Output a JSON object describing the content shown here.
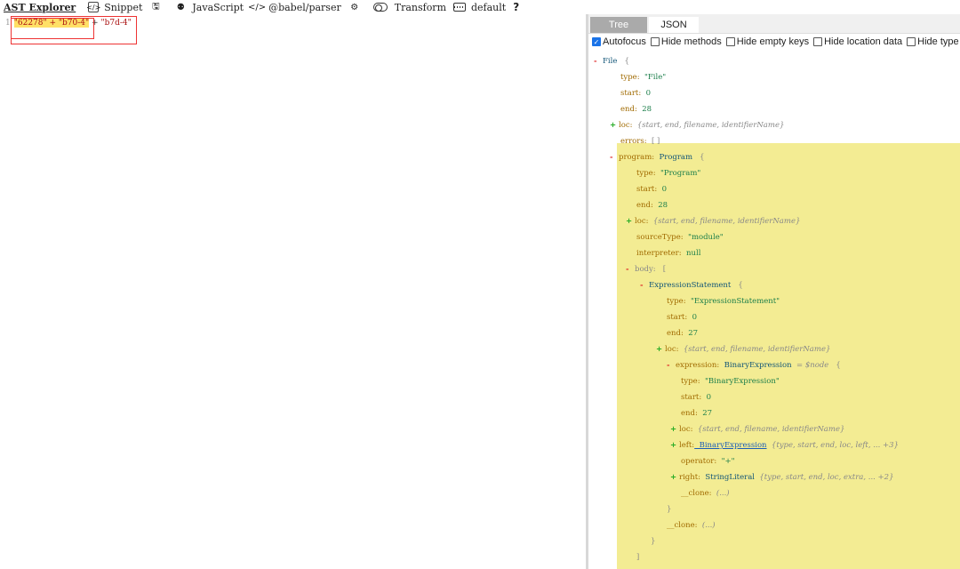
{
  "toolbar": {
    "brand": "AST Explorer",
    "snippet": "Snippet",
    "language": "JavaScript",
    "parser": "@babel/parser",
    "transform": "Transform",
    "theme": "default",
    "help": "?"
  },
  "editor": {
    "line_number": "1",
    "code_highlighted": "\"62278\" + \"b70-4\"",
    "code_op": " + ",
    "code_rest": "\"b7d-4\""
  },
  "panel": {
    "tabs": [
      "Tree",
      "JSON"
    ],
    "options": [
      {
        "label": "Autofocus",
        "checked": true
      },
      {
        "label": "Hide methods",
        "checked": false
      },
      {
        "label": "Hide empty keys",
        "checked": false
      },
      {
        "label": "Hide location data",
        "checked": false
      },
      {
        "label": "Hide type",
        "checked": false
      }
    ]
  },
  "tree": [
    {
      "toggle": "-",
      "key": "File",
      "kind": "type",
      "suffix": "{"
    },
    {
      "toggle": "",
      "key": "type:",
      "value": "\"File\"",
      "vt": "str"
    },
    {
      "toggle": "",
      "key": "start:",
      "value": "0",
      "vt": "num"
    },
    {
      "toggle": "",
      "key": "end:",
      "value": "28",
      "vt": "num"
    },
    {
      "toggle": "+",
      "key": "loc:",
      "value": "{start, end, filename, identifierName}",
      "vt": "meta"
    },
    {
      "toggle": "",
      "key": "errors:",
      "value": "[ ]",
      "vt": "brace"
    },
    {
      "toggle": "-",
      "key": "program:",
      "value": "Program",
      "vt": "tname",
      "suffix": "{"
    },
    {
      "toggle": "",
      "key": "type:",
      "value": "\"Program\"",
      "vt": "str"
    },
    {
      "toggle": "",
      "key": "start:",
      "value": "0",
      "vt": "num"
    },
    {
      "toggle": "",
      "key": "end:",
      "value": "28",
      "vt": "num"
    },
    {
      "toggle": "+",
      "key": "loc:",
      "value": "{start, end, filename, identifierName}",
      "vt": "meta"
    },
    {
      "toggle": "",
      "key": "sourceType:",
      "value": "\"module\"",
      "vt": "str"
    },
    {
      "toggle": "",
      "key": "interpreter:",
      "value": "null",
      "vt": "null"
    },
    {
      "toggle": "-",
      "key": "body:",
      "value": "",
      "vt": "brace",
      "suffix": "["
    },
    {
      "toggle": "-",
      "key": "ExpressionStatement",
      "kind": "type",
      "suffix": "{"
    },
    {
      "toggle": "",
      "key": "type:",
      "value": "\"ExpressionStatement\"",
      "vt": "str"
    },
    {
      "toggle": "",
      "key": "start:",
      "value": "0",
      "vt": "num"
    },
    {
      "toggle": "",
      "key": "end:",
      "value": "27",
      "vt": "num"
    },
    {
      "toggle": "+",
      "key": "loc:",
      "value": "{start, end, filename, identifierName}",
      "vt": "meta"
    },
    {
      "toggle": "-",
      "key": "expression:",
      "value": "BinaryExpression",
      "vt": "tname",
      "extra": "= $node",
      "suffix": "{"
    },
    {
      "toggle": "",
      "key": "type:",
      "value": "\"BinaryExpression\"",
      "vt": "str"
    },
    {
      "toggle": "",
      "key": "start:",
      "value": "0",
      "vt": "num"
    },
    {
      "toggle": "",
      "key": "end:",
      "value": "27",
      "vt": "num"
    },
    {
      "toggle": "+",
      "key": "loc:",
      "value": "{start, end, filename, identifierName}",
      "vt": "meta"
    },
    {
      "toggle": "+",
      "key": "left:",
      "value": "BinaryExpression",
      "vt": "link",
      "extra": "{type, start, end, loc, left, ... +3}"
    },
    {
      "toggle": "",
      "key": "operator:",
      "value": "\"+\"",
      "vt": "str"
    },
    {
      "toggle": "+",
      "key": "right:",
      "value": "StringLiteral",
      "vt": "tname",
      "extra": "{type, start, end, loc, extra, ... +2}"
    },
    {
      "toggle": "",
      "key": "__clone:",
      "value": "(...)",
      "vt": "meta"
    },
    {
      "toggle": "",
      "key": "}",
      "value": "",
      "vt": "brace"
    },
    {
      "toggle": "",
      "key": "__clone:",
      "value": "(...)",
      "vt": "meta"
    },
    {
      "toggle": "",
      "key": "}",
      "value": "",
      "vt": "brace"
    },
    {
      "toggle": "",
      "key": "]",
      "value": "",
      "vt": "brace"
    },
    {
      "toggle": "",
      "key": "directives:",
      "value": "[ ]",
      "vt": "brace"
    },
    {
      "toggle": "",
      "key": "__clone:",
      "value": "(...)",
      "vt": "meta"
    }
  ]
}
